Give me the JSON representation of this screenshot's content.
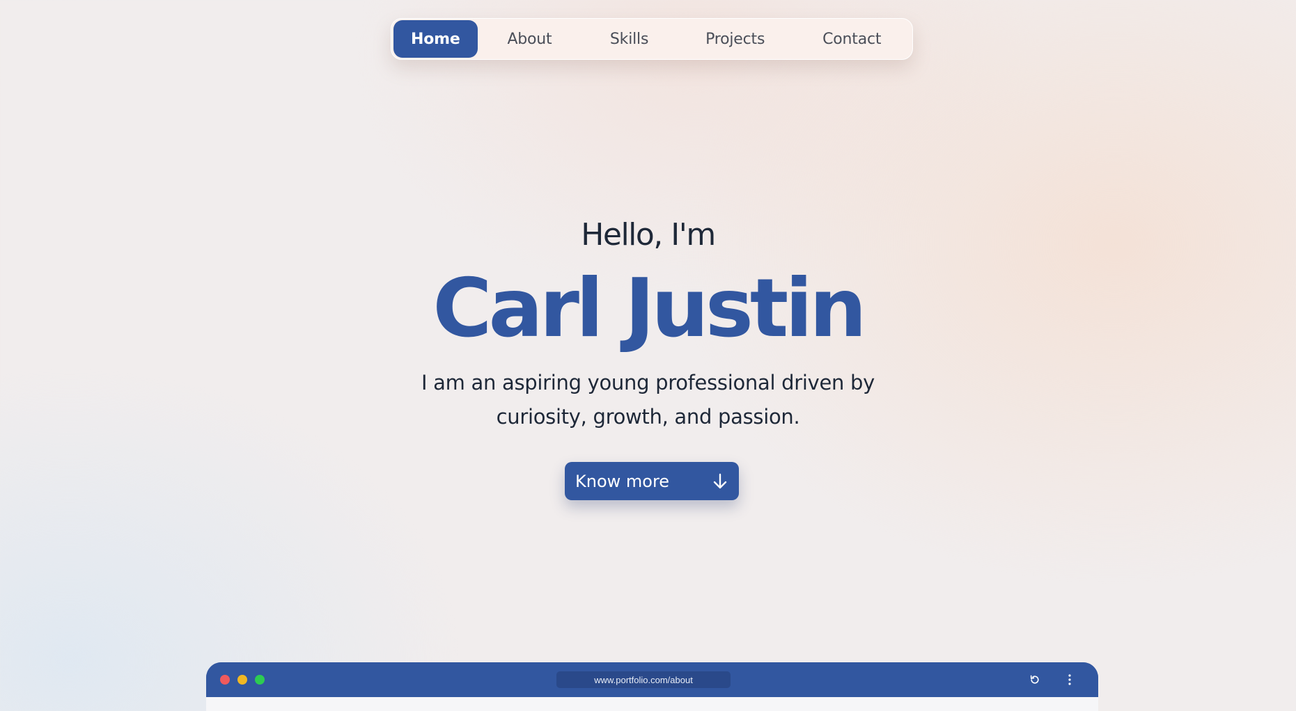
{
  "nav": {
    "items": [
      {
        "label": "Home",
        "active": true
      },
      {
        "label": "About",
        "active": false
      },
      {
        "label": "Skills",
        "active": false
      },
      {
        "label": "Projects",
        "active": false
      },
      {
        "label": "Contact",
        "active": false
      }
    ]
  },
  "hero": {
    "greeting": "Hello, I'm",
    "name": "Carl Justin",
    "tagline": "I am an aspiring young professional driven by curiosity, growth, and passion.",
    "cta_label": "Know more",
    "cta_icon": "arrow-down-icon"
  },
  "browser": {
    "url": "www.portfolio.com/about",
    "reload_icon": "reload-icon",
    "menu_icon": "kebab-menu-icon"
  },
  "colors": {
    "accent": "#3257a0",
    "text": "#1e2838",
    "dot_red": "#ef5a5d",
    "dot_yellow": "#f1b824",
    "dot_green": "#2dcc52"
  }
}
